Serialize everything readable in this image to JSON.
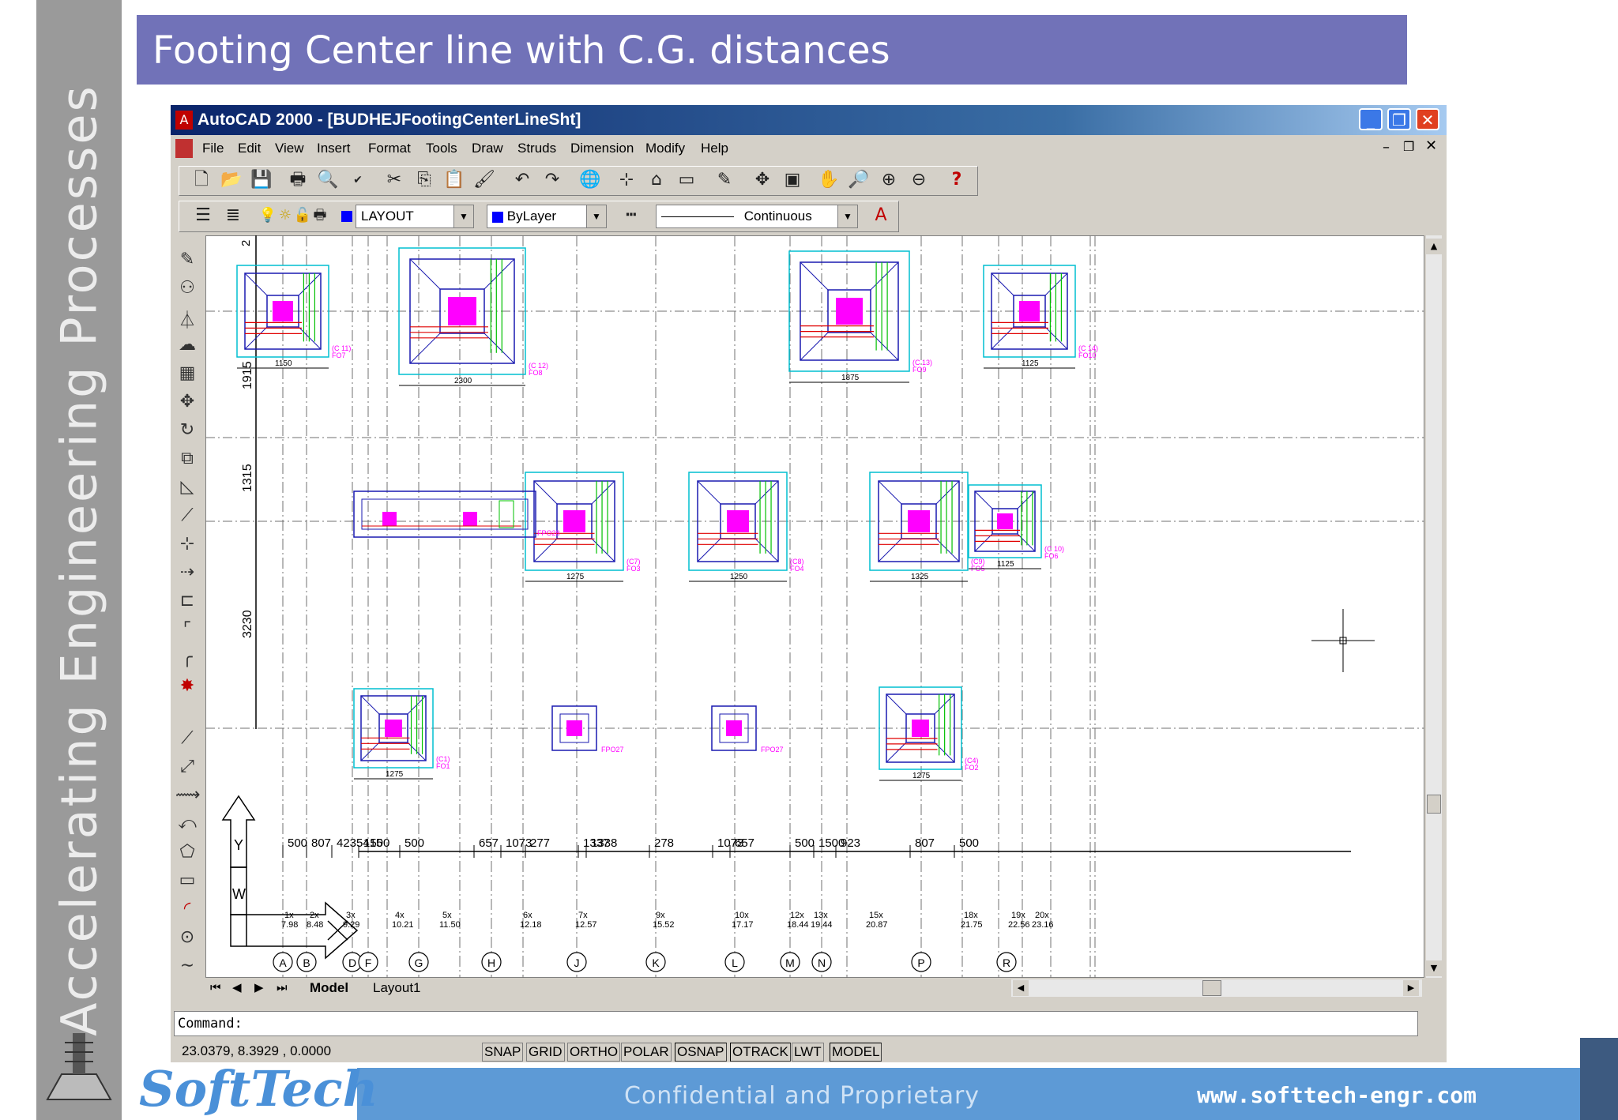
{
  "slide": {
    "title": "Footing Center line with C.G. distances",
    "vertical_tagline": "Accelerating Engineering Processes",
    "footer_text": "Confidential  and  Proprietary",
    "footer_url": "www.softtech-engr.com",
    "logo_text": "SoftTech"
  },
  "window": {
    "title": "AutoCAD 2000 - [BUDHEJFootingCenterLineSht]",
    "controls": [
      "_",
      "❐",
      "✕"
    ]
  },
  "menu": [
    "File",
    "Edit",
    "View",
    "Insert",
    "Format",
    "Tools",
    "Draw",
    "Struds",
    "Dimension",
    "Modify",
    "Help"
  ],
  "layer_toolbar": {
    "layer": "LAYOUT",
    "color": "ByLayer",
    "linetype": "Continuous"
  },
  "drawing": {
    "vertical_dims": [
      "2",
      "1915",
      "1315",
      "3230"
    ],
    "column_dims": [
      "500",
      "807",
      "4235415",
      "1500",
      "500",
      "657",
      "1073",
      "277",
      "1337",
      "1338",
      "278",
      "1073",
      "657",
      "500",
      "1500",
      "923",
      "807",
      "500"
    ],
    "gridline_labels": [
      "A",
      "B",
      "D",
      "F",
      "G",
      "H",
      "J",
      "K",
      "L",
      "M",
      "N",
      "P",
      "R"
    ],
    "cg_labels": [
      {
        "top": "1x",
        "bot": "7.98"
      },
      {
        "top": "2x",
        "bot": "8.48"
      },
      {
        "top": "3x",
        "bot": "9.29"
      },
      {
        "top": "4x",
        "bot": "10.21"
      },
      {
        "top": "5x",
        "bot": "11.50"
      },
      {
        "top": "6x",
        "bot": "12.18"
      },
      {
        "top": "7x",
        "bot": "12.57"
      },
      {
        "top": "9x",
        "bot": "15.52"
      },
      {
        "top": "10x",
        "bot": "17.17"
      },
      {
        "top": "12x",
        "bot": "18.44"
      },
      {
        "top": "13x",
        "bot": "19.44"
      },
      {
        "top": "15x",
        "bot": "20.87"
      },
      {
        "top": "18x",
        "bot": "21.75"
      },
      {
        "top": "19x",
        "bot": "22.56"
      },
      {
        "top": "20x",
        "bot": "23.16"
      }
    ],
    "footing_labels": [
      "(C 11)\nFO7",
      "(C 12)\nFO8",
      "(C 13)\nFO9",
      "(C 14)\nFO10",
      "FPO28",
      "(C7)\nFO3",
      "(C8)\nFO4",
      "(C9)\nFO5",
      "(C 10)\nFO6",
      "(C1)\nFO1",
      "FPO27",
      "FPO27",
      "(C4)\nFO2"
    ],
    "footing_widths": [
      "1150",
      "2300",
      "1875",
      "1125",
      "1275",
      "1250",
      "1325",
      "1125",
      "1275",
      "1275"
    ],
    "ucs_labels": [
      "Y",
      "W",
      "X"
    ]
  },
  "tabs": [
    "Model",
    "Layout1"
  ],
  "command": {
    "prompt": "Command:"
  },
  "status": {
    "coords": "23.0379, 8.3929 , 0.0000",
    "buttons": [
      "SNAP",
      "GRID",
      "ORTHO",
      "POLAR",
      "OSNAP",
      "OTRACK",
      "LWT",
      "MODEL"
    ]
  },
  "colors": {
    "titlebar": "#7172b8",
    "footing_outer": "#00bfd0",
    "footing_inner": "#1a1ab0",
    "column": "#ff00ff",
    "rebar_red": "#e00000",
    "rebar_green": "#00c000"
  }
}
